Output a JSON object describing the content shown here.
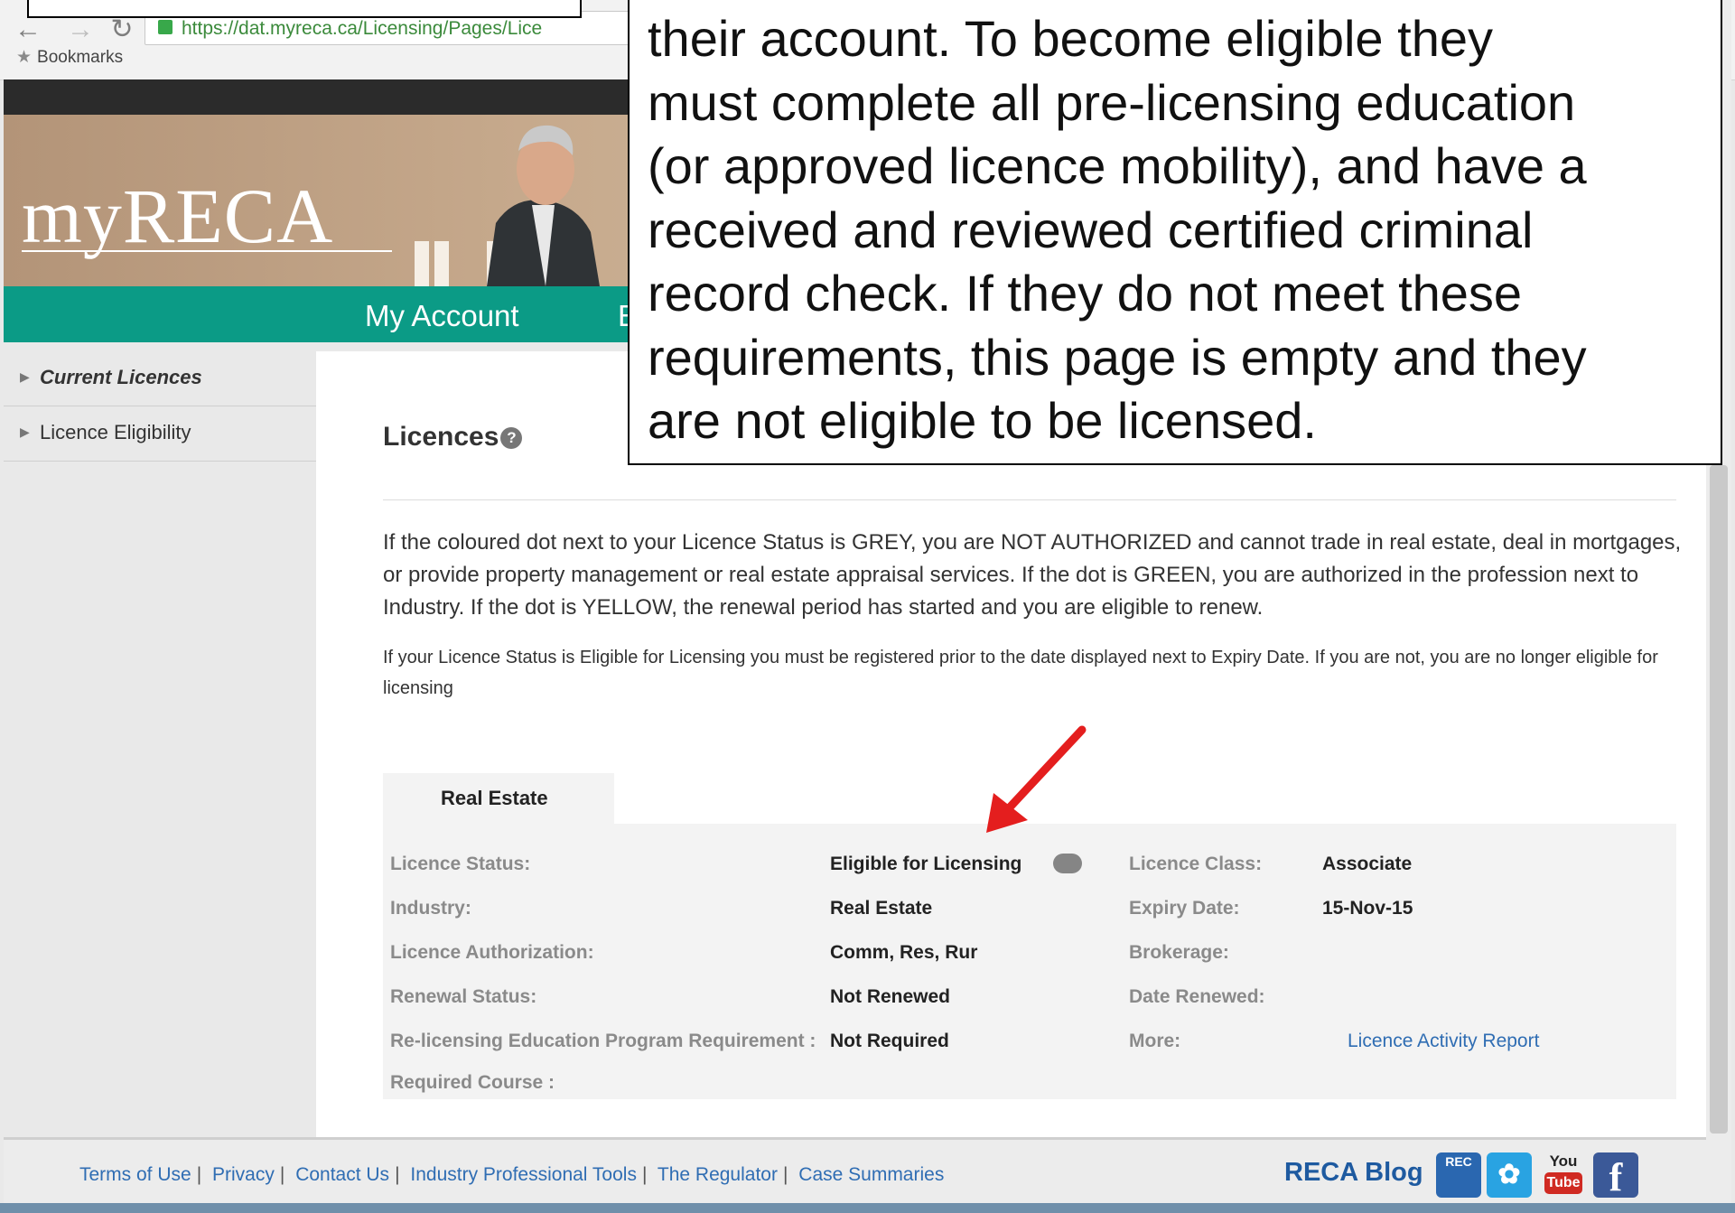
{
  "browser": {
    "url": "https://dat.myreca.ca/Licensing/Pages/Lice",
    "bookmarks_label": "Bookmarks"
  },
  "site": {
    "logo_text": "myRECA",
    "nav": {
      "my_account": "My Account",
      "partial_item": "E"
    }
  },
  "sidebar": {
    "items": [
      {
        "label": "Current Licences"
      },
      {
        "label": "Licence Eligibility"
      }
    ]
  },
  "main": {
    "title": "Licences",
    "help_glyph": "?",
    "paragraph1": "If the coloured dot next to your Licence Status is GREY, you are NOT AUTHORIZED and cannot trade in real estate, deal in mortgages, or provide property management or real estate appraisal services. If the dot is GREEN, you are authorized in the profession next to Industry. If the dot is YELLOW, the renewal period has started and you are eligible to renew.",
    "paragraph2": "If your Licence Status is Eligible for Licensing you must be registered prior to the date displayed next to Expiry Date. If you are not, you are no longer eligible for licensing",
    "tab_label": "Real Estate",
    "fields": {
      "licence_status_label": "Licence Status:",
      "licence_status_value": "Eligible for Licensing",
      "industry_label": "Industry:",
      "industry_value": "Real Estate",
      "authorization_label": "Licence Authorization:",
      "authorization_value": "Comm, Res, Rur",
      "renewal_status_label": "Renewal Status:",
      "renewal_status_value": "Not Renewed",
      "education_label": "Re-licensing Education Program Requirement :",
      "education_value": "Not Required",
      "required_course_label": "Required Course :",
      "licence_class_label": "Licence Class:",
      "licence_class_value": "Associate",
      "expiry_date_label": "Expiry Date:",
      "expiry_date_value": "15-Nov-15",
      "brokerage_label": "Brokerage:",
      "date_renewed_label": "Date Renewed:",
      "more_label": "More:",
      "activity_report_link": "Licence Activity Report"
    },
    "status_dot_color": "#858585"
  },
  "footer": {
    "links": [
      "Terms of Use",
      "Privacy",
      "Contact Us",
      "Industry Professional Tools",
      "The Regulator",
      "Case Summaries"
    ],
    "blog_label": "RECA Blog",
    "icon_labels": {
      "reca": "REC",
      "twitter": "✓",
      "youtube_top": "You",
      "youtube_bottom": "Tube",
      "facebook": "f"
    }
  },
  "callout": {
    "lines": [
      "their account. To become eligible they",
      "must complete all pre-licensing education",
      "(or approved licence mobility), and have a",
      "received and reviewed certified criminal",
      "record check. If they do not meet these",
      "requirements, this page is empty and they",
      "are not eligible to be licensed."
    ]
  },
  "colors": {
    "nav_green": "#0b9b86",
    "link_blue": "#2f6db3",
    "arrow_red": "#e41e1e"
  }
}
